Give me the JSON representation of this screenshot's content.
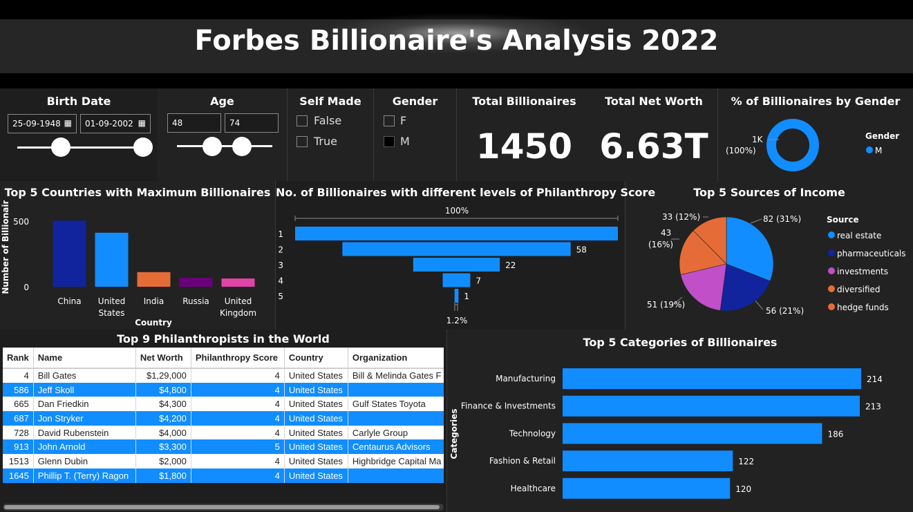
{
  "title": "Forbes Billionaire's Analysis 2022",
  "filters": {
    "birth_date": {
      "label": "Birth Date",
      "start": "25-09-1948",
      "end": "01-09-2002",
      "calendar_icon": "calendar-icon"
    },
    "age": {
      "label": "Age",
      "min": "48",
      "max": "74"
    },
    "self_made": {
      "label": "Self Made",
      "options": [
        "False",
        "True"
      ]
    },
    "gender": {
      "label": "Gender",
      "options": [
        "F",
        "M"
      ],
      "selected": "M"
    }
  },
  "kpis": {
    "total_billionaires": {
      "label": "Total Billionaires",
      "value": "1450"
    },
    "total_net_worth": {
      "label": "Total Net Worth",
      "value": "6.63T"
    }
  },
  "gender_donut": {
    "title": "% of Billionaires by Gender",
    "data_label_count": "1K",
    "data_label_pct": "(100%)",
    "legend_title": "Gender",
    "legend_item": "M",
    "color": "#118dff"
  },
  "countries_chart": {
    "title": "Top 5 Countries with Maximum Billionaires",
    "ylabel": "Number of Billionaires",
    "xlabel": "Country",
    "ticks": [
      "500",
      "0"
    ],
    "category_lines": [
      [
        "China"
      ],
      [
        "United",
        "States"
      ],
      [
        "India"
      ],
      [
        "Russia"
      ],
      [
        "United",
        "Kingdom"
      ]
    ]
  },
  "philanthropy_chart": {
    "title": "No. of Billionaires with different levels of Philanthropy Score",
    "top_label": "100%",
    "bottom_label": "1.2%"
  },
  "income_chart": {
    "title": "Top 5 Sources of Income",
    "legend_title": "Source",
    "labels": [
      "82 (31%)",
      "56 (21%)",
      "51 (19%)",
      "43",
      "(16%)",
      "33 (12%)"
    ]
  },
  "table": {
    "title": "Top 9 Philanthropists in the World",
    "headers": [
      "Rank",
      "Name",
      "Net Worth",
      "Philanthropy Score",
      "Country",
      "Organization"
    ],
    "rows": [
      [
        "4",
        "Bill Gates",
        "$1,29,000",
        "4",
        "United States",
        "Bill & Melinda Gates F"
      ],
      [
        "586",
        "Jeff Skoll",
        "$4,800",
        "4",
        "United States",
        ""
      ],
      [
        "665",
        "Dan Friedkin",
        "$4,300",
        "4",
        "United States",
        "Gulf States Toyota"
      ],
      [
        "687",
        "Jon Stryker",
        "$4,200",
        "4",
        "United States",
        ""
      ],
      [
        "728",
        "David Rubenstein",
        "$4,000",
        "4",
        "United States",
        "Carlyle Group"
      ],
      [
        "913",
        "John Arnold",
        "$3,300",
        "5",
        "United States",
        "Centaurus Advisors"
      ],
      [
        "1513",
        "Glenn Dubin",
        "$2,000",
        "4",
        "United States",
        "Highbridge Capital Ma"
      ],
      [
        "1645",
        "Phillip T. (Terry) Ragon",
        "$1,800",
        "4",
        "United States",
        ""
      ]
    ]
  },
  "categories_chart": {
    "title": "Top 5 Categories of Billionaires",
    "ylabel": "Categories"
  },
  "chart_data": [
    {
      "type": "bar",
      "title": "Top 5 Countries with Maximum Billionaires",
      "xlabel": "Country",
      "ylabel": "Number of Billionaires",
      "categories": [
        "China",
        "United States",
        "India",
        "Russia",
        "United Kingdom"
      ],
      "values": [
        520,
        425,
        115,
        70,
        65
      ],
      "colors": [
        "#12239e",
        "#118dff",
        "#e66c37",
        "#6b007b",
        "#e044a7"
      ],
      "ylim": [
        0,
        500
      ]
    },
    {
      "type": "bar",
      "title": "No. of Billionaires with different levels of Philanthropy Score",
      "categories": [
        "1",
        "2",
        "3",
        "4",
        "5"
      ],
      "values": [
        82,
        58,
        22,
        7,
        1
      ],
      "color": "#118dff"
    },
    {
      "type": "pie",
      "title": "Top 5 Sources of Income",
      "legend_title": "Source",
      "categories": [
        "real estate",
        "pharmaceuticals",
        "investments",
        "diversified",
        "hedge funds"
      ],
      "values": [
        82,
        56,
        51,
        43,
        33
      ],
      "colors": [
        "#118dff",
        "#12239e",
        "#c04fc8",
        "#e66c37",
        "#e66c37"
      ]
    },
    {
      "type": "bar",
      "title": "Top 5 Categories of Billionaires",
      "ylabel": "Categories",
      "categories": [
        "Manufacturing",
        "Finance & Investments",
        "Technology",
        "Fashion & Retail",
        "Healthcare"
      ],
      "values": [
        214,
        213,
        186,
        122,
        120
      ],
      "color": "#118dff"
    }
  ]
}
